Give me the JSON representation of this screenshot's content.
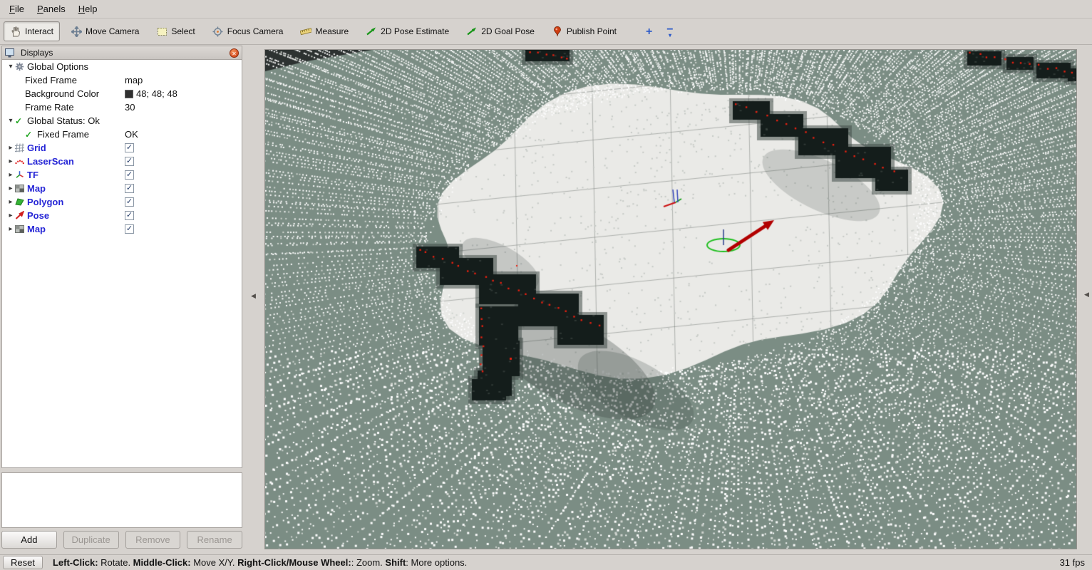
{
  "menu": {
    "items": [
      {
        "label": "File"
      },
      {
        "label": "Panels"
      },
      {
        "label": "Help"
      }
    ]
  },
  "toolbar": {
    "buttons": [
      {
        "label": "Interact",
        "icon": "hand-icon",
        "active": true
      },
      {
        "label": "Move Camera",
        "icon": "move-camera-icon",
        "active": false
      },
      {
        "label": "Select",
        "icon": "select-box-icon",
        "active": false
      },
      {
        "label": "Focus Camera",
        "icon": "focus-camera-icon",
        "active": false
      },
      {
        "label": "Measure",
        "icon": "measure-icon",
        "active": false
      },
      {
        "label": "2D Pose Estimate",
        "icon": "pose-estimate-icon",
        "active": false
      },
      {
        "label": "2D Goal Pose",
        "icon": "goal-pose-icon",
        "active": false
      },
      {
        "label": "Publish Point",
        "icon": "publish-point-icon",
        "active": false
      }
    ],
    "add_tool_label": "+",
    "remove_tool_label": "−"
  },
  "displays_panel": {
    "title": "Displays",
    "rows": [
      {
        "indent": 0,
        "arrow": "expanded",
        "icon": "gear",
        "label": "Global Options",
        "blue": false,
        "value_type": null,
        "value": ""
      },
      {
        "indent": 1,
        "arrow": null,
        "icon": null,
        "label": "Fixed Frame",
        "blue": false,
        "value_type": "text",
        "value": "map"
      },
      {
        "indent": 1,
        "arrow": null,
        "icon": null,
        "label": "Background Color",
        "blue": false,
        "value_type": "color",
        "value": "48; 48; 48",
        "swatch": "#303030"
      },
      {
        "indent": 1,
        "arrow": null,
        "icon": null,
        "label": "Frame Rate",
        "blue": false,
        "value_type": "text",
        "value": "30"
      },
      {
        "indent": 0,
        "arrow": "expanded",
        "icon": "check",
        "label": "Global Status: Ok",
        "blue": false,
        "value_type": null,
        "value": ""
      },
      {
        "indent": 1,
        "arrow": null,
        "icon": "check",
        "label": "Fixed Frame",
        "blue": false,
        "value_type": "text",
        "value": "OK"
      },
      {
        "indent": 0,
        "arrow": "collapsed",
        "icon": "grid",
        "label": "Grid",
        "blue": true,
        "value_type": "checkbox",
        "checked": true
      },
      {
        "indent": 0,
        "arrow": "collapsed",
        "icon": "laserscan",
        "label": "LaserScan",
        "blue": true,
        "value_type": "checkbox",
        "checked": true
      },
      {
        "indent": 0,
        "arrow": "collapsed",
        "icon": "tf",
        "label": "TF",
        "blue": true,
        "value_type": "checkbox",
        "checked": true
      },
      {
        "indent": 0,
        "arrow": "collapsed",
        "icon": "map",
        "label": "Map",
        "blue": true,
        "value_type": "checkbox",
        "checked": true
      },
      {
        "indent": 0,
        "arrow": "collapsed",
        "icon": "polygon",
        "label": "Polygon",
        "blue": true,
        "value_type": "checkbox",
        "checked": true
      },
      {
        "indent": 0,
        "arrow": "collapsed",
        "icon": "pose",
        "label": "Pose",
        "blue": true,
        "value_type": "checkbox",
        "checked": true
      },
      {
        "indent": 0,
        "arrow": "collapsed",
        "icon": "map",
        "label": "Map",
        "blue": true,
        "value_type": "checkbox",
        "checked": true
      }
    ],
    "buttons": [
      {
        "label": "Add",
        "enabled": true
      },
      {
        "label": "Duplicate",
        "enabled": false
      },
      {
        "label": "Remove",
        "enabled": false
      },
      {
        "label": "Rename",
        "enabled": false
      }
    ]
  },
  "status_bar": {
    "reset_label": "Reset",
    "help_segments": [
      {
        "text": "Left-Click:",
        "bold": true
      },
      {
        "text": " Rotate. ",
        "bold": false
      },
      {
        "text": "Middle-Click:",
        "bold": true
      },
      {
        "text": " Move X/Y. ",
        "bold": false
      },
      {
        "text": "Right-Click/Mouse Wheel:",
        "bold": true
      },
      {
        "text": ": Zoom. ",
        "bold": false
      },
      {
        "text": "Shift",
        "bold": true
      },
      {
        "text": ": More options.",
        "bold": false
      }
    ],
    "fps": "31 fps"
  },
  "viewport": {
    "colors": {
      "unknown_space": "#7b8d84",
      "free_space": "#eaeae7",
      "far_background": "#2d3231",
      "obstacle": "#141d1b",
      "obstacle_fringe": "rgba(66,76,72,0.55)",
      "scan_point": "#fdfdfd",
      "scan_point_dim": "#cfd4cf",
      "laser_red": "#e82010",
      "robot_arrow": "#b20000",
      "selection_circle": "#21c021",
      "grid_line": "rgba(115,122,117,0.5)"
    }
  },
  "glyphs": {
    "expanded": "▾",
    "collapsed": "▸",
    "check": "✓",
    "close": "✕",
    "collapse_left": "◀",
    "caret_down": "▾"
  }
}
